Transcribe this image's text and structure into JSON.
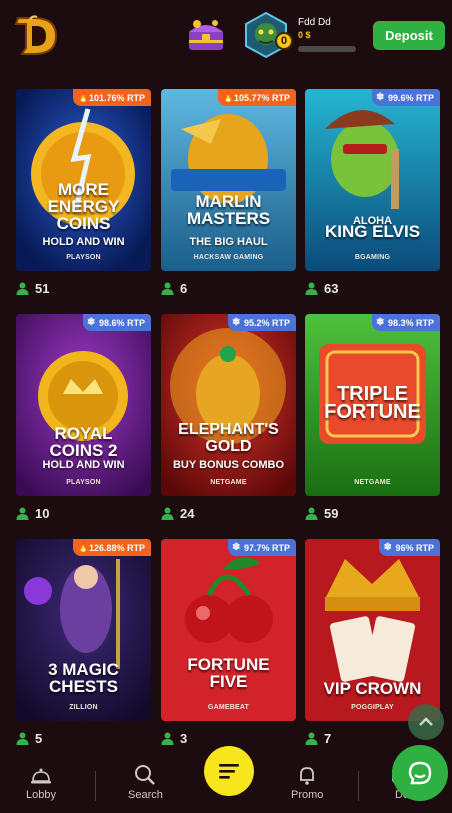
{
  "header": {
    "username": "Fdd Dd",
    "balance": "0 $",
    "level": "0",
    "deposit_label": "Deposit",
    "xp_progress": 0
  },
  "games": [
    {
      "title_lines": [
        "MORE",
        "ENERGY",
        "COINS"
      ],
      "subtitle": "HOLD AND WIN",
      "provider": "PLAYSON",
      "rtp": "101.76% RTP",
      "rtp_kind": "hot",
      "players": "51"
    },
    {
      "title_lines": [
        "MARLIN",
        "MASTERS"
      ],
      "subtitle": "THE BIG HAUL",
      "provider": "HACKSAW GAMING",
      "rtp": "105.77% RTP",
      "rtp_kind": "hot",
      "players": "6"
    },
    {
      "title_lines": [
        "ALOHA",
        "KING ELVIS"
      ],
      "subtitle": "",
      "provider": "BGAMING",
      "rtp": "99.6% RTP",
      "rtp_kind": "cold",
      "players": "63"
    },
    {
      "title_lines": [
        "ROYAL",
        "COINS 2"
      ],
      "subtitle": "HOLD AND WIN",
      "provider": "PLAYSON",
      "rtp": "98.6% RTP",
      "rtp_kind": "cold",
      "players": "10"
    },
    {
      "title_lines": [
        "ELEPHANT'S",
        "GOLD"
      ],
      "subtitle": "BUY BONUS COMBO",
      "provider": "NETGAME",
      "rtp": "95.2% RTP",
      "rtp_kind": "cold",
      "players": "24"
    },
    {
      "title_lines": [
        "TRIPLE",
        "FORTUNE"
      ],
      "subtitle": "",
      "provider": "NETGAME",
      "rtp": "98.3% RTP",
      "rtp_kind": "cold",
      "players": "59"
    },
    {
      "title_lines": [
        "3 MAGIC",
        "CHESTS"
      ],
      "subtitle": "",
      "provider": "ZILLION",
      "rtp": "126.88% RTP",
      "rtp_kind": "hot",
      "players": "5"
    },
    {
      "title_lines": [
        "FORTUNE",
        "FIVE"
      ],
      "subtitle": "",
      "provider": "GAMEBEAT",
      "rtp": "97.7% RTP",
      "rtp_kind": "cold",
      "players": "3"
    },
    {
      "title_lines": [
        "VIP CROWN"
      ],
      "subtitle": "",
      "provider": "POGGIPLAY",
      "rtp": "96% RTP",
      "rtp_kind": "cold",
      "players": "7"
    }
  ],
  "nav": {
    "lobby": "Lobby",
    "search": "Search",
    "promo": "Promo",
    "deposit": "De"
  },
  "colors": {
    "accent_green": "#2fb043",
    "fab_yellow": "#f7e61c",
    "rtp_hot": "#f0641e",
    "rtp_cold": "#4a72d9"
  }
}
